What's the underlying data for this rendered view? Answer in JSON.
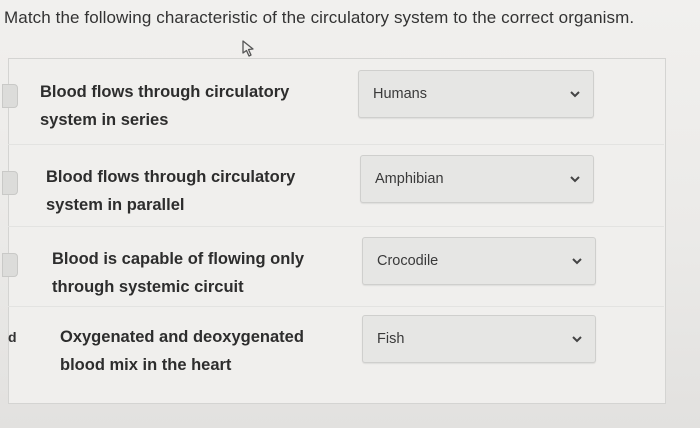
{
  "question": {
    "text": "Match the following characteristic of the circulatory system to the correct organism."
  },
  "side_marker_text": "d",
  "matches": [
    {
      "label_line1": "Blood flows through circulatory",
      "label_line2": "system in series",
      "selected": "Humans"
    },
    {
      "label_line1": "Blood flows through circulatory",
      "label_line2": "system in parallel",
      "selected": "Amphibian"
    },
    {
      "label_line1": "Blood is capable of flowing only",
      "label_line2": "through systemic circuit",
      "selected": "Crocodile"
    },
    {
      "label_line1": "Oxygenated and deoxygenated",
      "label_line2": "blood mix in the heart",
      "selected": "Fish"
    }
  ],
  "icons": {
    "dropdown": "chevron-down-icon",
    "pointer": "mouse-cursor-icon"
  }
}
